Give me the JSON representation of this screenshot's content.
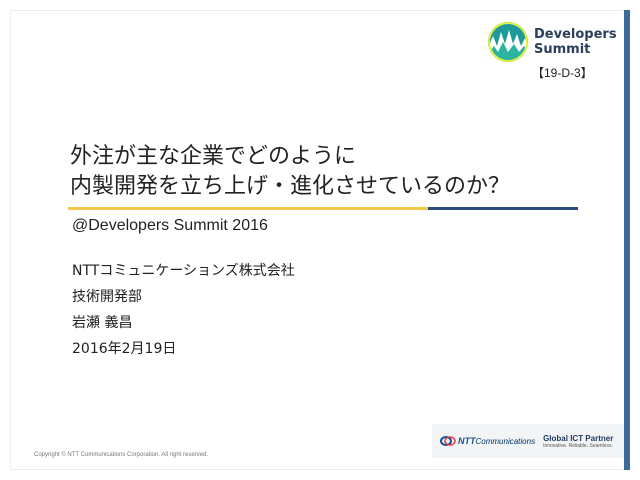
{
  "event_logo": {
    "line1": "Developers",
    "line2": "Summit"
  },
  "session_code": "【19-D-3】",
  "title": {
    "line1": "外注が主な企業でどのように",
    "line2": "内製開発を立ち上げ・進化させているのか？"
  },
  "subtitle": "@Developers Summit 2016",
  "presenter": {
    "company": "NTTコミュニケーションズ株式会社",
    "department": "技術開発部",
    "name": "岩瀬 義昌",
    "date": "2016年2月19日"
  },
  "footer": {
    "copyright": "Copyright © NTT Communications Corporation. All right reserved.",
    "ntt_prefix": "NTT",
    "ntt_suffix": "Communications",
    "tagline": "Global ICT Partner",
    "tagline_sub": "Innovative. Reliable. Seamless."
  },
  "colors": {
    "accent_gold": "#f2c94c",
    "accent_blue": "#2a4b7c",
    "logo_teal": "#28a4a4"
  }
}
